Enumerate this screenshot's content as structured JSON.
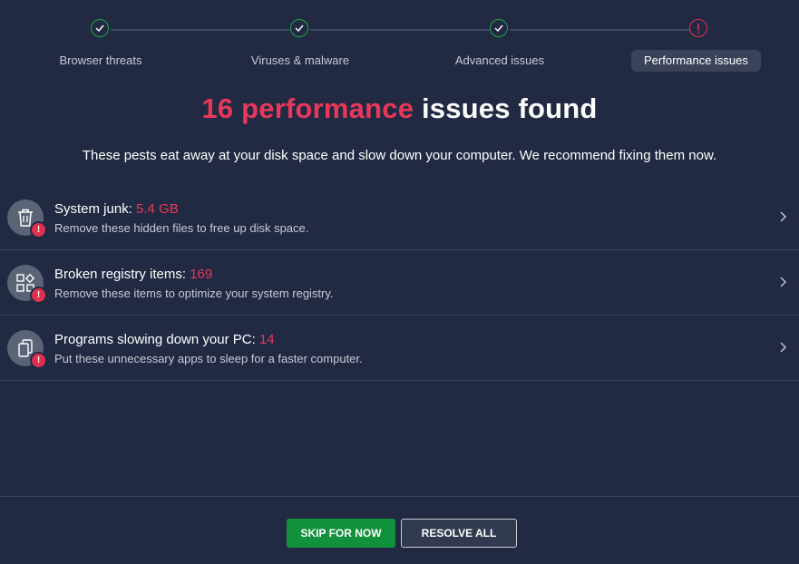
{
  "stepper": {
    "steps": [
      {
        "label": "Browser threats",
        "status": "done",
        "icon": "check-icon"
      },
      {
        "label": "Viruses & malware",
        "status": "done",
        "icon": "check-icon"
      },
      {
        "label": "Advanced issues",
        "status": "done",
        "icon": "check-icon"
      },
      {
        "label": "Performance issues",
        "status": "active-alert",
        "icon": "exclamation-icon"
      }
    ]
  },
  "heading": {
    "count_text": "16 performance",
    "rest_text": " issues found"
  },
  "subtitle": "These pests eat away at your disk space and slow down your computer. We recommend fixing them now.",
  "issues": [
    {
      "title": "System junk:",
      "value": "5.4 GB",
      "description": "Remove these hidden files to free up disk space.",
      "icon": "trash-icon",
      "badge": "!"
    },
    {
      "title": "Broken registry items:",
      "value": "169",
      "description": "Remove these items to optimize your system registry.",
      "icon": "registry-icon",
      "badge": "!"
    },
    {
      "title": "Programs slowing down your PC:",
      "value": "14",
      "description": "Put these unnecessary apps to sleep for a faster computer.",
      "icon": "apps-icon",
      "badge": "!"
    }
  ],
  "footer": {
    "skip_label": "SKIP FOR NOW",
    "resolve_label": "RESOLVE ALL"
  },
  "colors": {
    "background": "#212a42",
    "accent_red": "#e8385a",
    "success_green": "#1fa34a",
    "skip_button": "#11913c"
  }
}
